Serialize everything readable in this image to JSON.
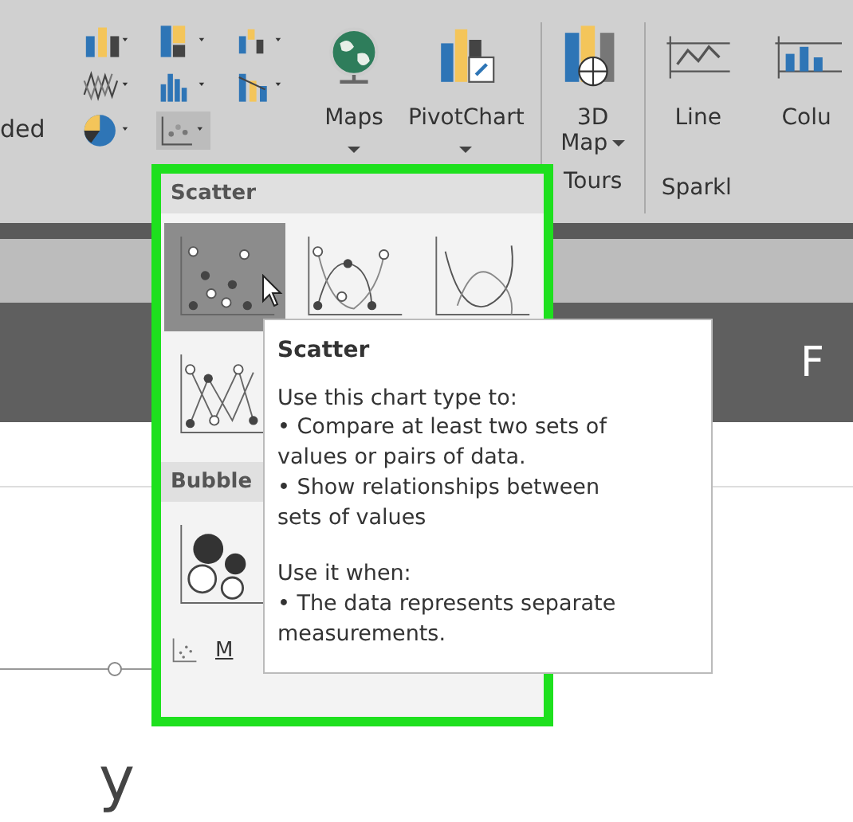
{
  "ribbon": {
    "partial_label": "ded",
    "buttons": [
      {
        "label": "Maps"
      },
      {
        "label": "PivotChart"
      }
    ],
    "tours": {
      "line1": "3D",
      "line2": "Map",
      "group": "Tours"
    },
    "sparklines": {
      "buttons": [
        "Line",
        "Colu"
      ],
      "group": "Sparkl"
    }
  },
  "scatter_menu": {
    "sections": [
      {
        "title": "Scatter",
        "charts": [
          {
            "kind": "scatter",
            "selected": true
          },
          {
            "kind": "smooth",
            "selected": false
          },
          {
            "kind": "smooth-lines",
            "selected": false
          },
          {
            "kind": "straight",
            "selected": false
          }
        ]
      },
      {
        "title": "Bubble",
        "charts": [
          {
            "kind": "bubble",
            "selected": false
          }
        ]
      }
    ],
    "more_label": "M"
  },
  "tooltip": {
    "title": "Scatter",
    "intro": "Use this chart type to:",
    "uses": [
      "• Compare at least two sets of values or pairs of data.",
      "• Show relationships between sets of values"
    ],
    "when_heading": "Use it when:",
    "when": [
      "• The data represents separate measurements."
    ]
  },
  "sheet": {
    "column_header": "F",
    "cell_text": "y"
  }
}
